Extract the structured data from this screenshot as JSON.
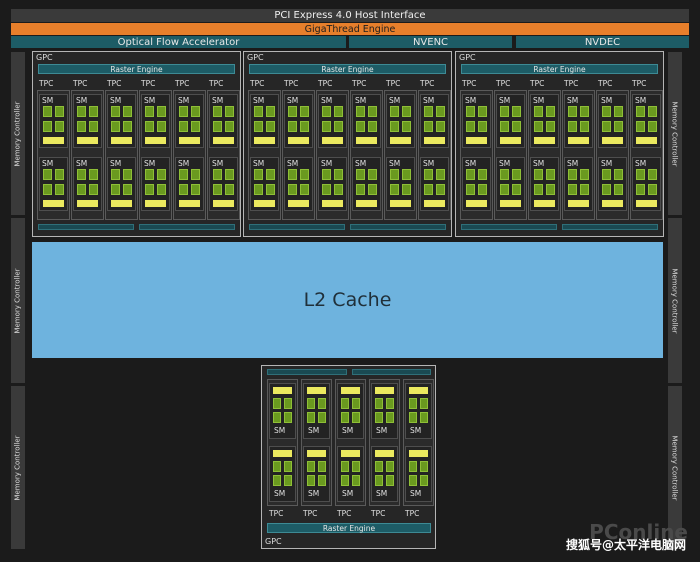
{
  "header": {
    "pcie": "PCI Express 4.0 Host Interface",
    "gigathread": "GigaThread Engine",
    "ofa": "Optical Flow Accelerator",
    "nvenc": "NVENC",
    "nvdec": "NVDEC"
  },
  "memory_controller_label": "Memory Controller",
  "gpc": {
    "label": "GPC",
    "raster_engine": "Raster Engine",
    "tpc_label": "TPC",
    "sm_label": "SM",
    "tpcs_per_gpc": 6,
    "tpcs_partial_gpc": 5
  },
  "l2_cache": "L2 Cache",
  "watermark": {
    "brand": "PConline",
    "source": "搜狐号@太平洋电脑网"
  },
  "colors": {
    "background": "#1b1b1b",
    "gigathread": "#e77f2b",
    "engine_teal": "#1d5c66",
    "l2_cache": "#6eb3de",
    "cuda_green": "#6a9a1f",
    "rt_yellow": "#ebe95f"
  }
}
